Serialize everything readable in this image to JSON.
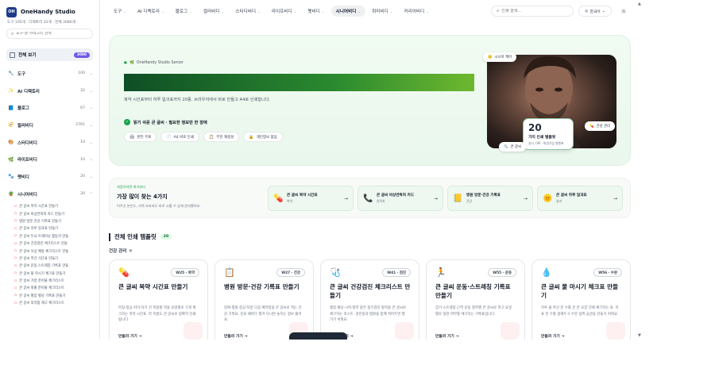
{
  "brand": {
    "name": "OneHandy Studio",
    "logo_text": "OH"
  },
  "sidebar": {
    "stats": "도구 105개 · 디렉토리 32개 · 전체 3080개",
    "search_placeholder": "도구·글 카테고리 검색",
    "all_view": {
      "label": "전체 보기",
      "count": "3080"
    },
    "categories": [
      {
        "icon": "🔧",
        "label": "도구",
        "count": "100",
        "chev": "⌄"
      },
      {
        "icon": "✨",
        "label": "AI 디렉토리",
        "count": "32",
        "chev": "⌄"
      },
      {
        "icon": "📘",
        "label": "블로그",
        "count": "67",
        "chev": "⌄"
      },
      {
        "icon": "🧭",
        "label": "컬러비디",
        "count": "2761",
        "chev": "⌄"
      },
      {
        "icon": "🎨",
        "label": "스터디비디",
        "count": "10",
        "chev": "⌄"
      },
      {
        "icon": "🌿",
        "label": "라이프비디",
        "count": "10",
        "chev": "⌄"
      },
      {
        "icon": "🐾",
        "label": "펫비디",
        "count": "20",
        "chev": "⌄"
      },
      {
        "icon": "🪴",
        "label": "시니어비디",
        "count": "20",
        "chev": "⌃"
      }
    ],
    "sub_items": [
      "큰 글씨 복약 시간표 만들기",
      "큰 글씨 비상연락처 카드 만들기",
      "병원 방문·건강 기록표 만들기",
      "큰 글씨 하루 일과표 만들기",
      "큰 글씨 두뇌 트레이닝 활동지 만들",
      "큰 글씨 건강검진 체크리스트 만들",
      "큰 글씨 낙상 예방 체크리스트 만들",
      "큰 글씨 주간 식단표 만들기",
      "큰 글씨 운동·스트레칭 기록표 만들",
      "큰 글씨 물 마시기 체크표 만들기",
      "큰 글씨 가방 준비물 체크리스트",
      "큰 글씨 외출 준비물 체크리스트",
      "큰 글씨 혈압 혈당 기록표 만들기",
      "큰 글씨 의약품 재고 체크리스트"
    ]
  },
  "nav": {
    "items": [
      {
        "label": "도구",
        "active": false
      },
      {
        "label": "AI 디렉토리",
        "active": false
      },
      {
        "label": "블로그",
        "active": false
      },
      {
        "label": "컬러비디",
        "active": false
      },
      {
        "label": "스터디비디",
        "active": false
      },
      {
        "label": "라이프비디",
        "active": false
      },
      {
        "label": "펫비디",
        "active": false
      },
      {
        "label": "시니어비디",
        "active": true
      },
      {
        "label": "취미비디",
        "active": false
      },
      {
        "label": "커리어비디",
        "active": false
      }
    ],
    "search_placeholder": "인쇄 검색...",
    "lang": "한국어"
  },
  "hero": {
    "kicker": "OneHandy Studio Senior",
    "desc": "복약 시간표부터 하루 일과표까지 20종. 브라우저에서 바로 만들고 A4로 인쇄합니다.",
    "check": "읽기 쉬운 큰 글씨 · 필요한 정보만 한 장에",
    "chips": [
      {
        "icon": "🖨",
        "label": "완전 무료"
      },
      {
        "icon": "📄",
        "label": "A4 바로 인쇄"
      },
      {
        "icon": "📋",
        "label": "무한 재생성"
      },
      {
        "icon": "🔒",
        "label": "개인정보 없음"
      }
    ],
    "pill_senior": "시니어 케어",
    "pill_health": "건강 관리",
    "pill_big": "큰 글씨",
    "count_num": "20",
    "count_title": "가지 인쇄 템플릿",
    "count_sub": "실시 기록 · 위생기입 병행표"
  },
  "popular": {
    "kicker": "처음이라면 여기부터",
    "title": "가장 많이 찾는 4가지",
    "desc": "어르신 본인도, 가족 보호자도 바로 고를 수 있게 준비했어요.",
    "cards": [
      {
        "icon": "💊",
        "title": "큰 글씨 복약 시간표",
        "sub": "복약"
      },
      {
        "icon": "📞",
        "title": "큰 글씨 비상연락처 카드",
        "sub": "연락처"
      },
      {
        "icon": "📒",
        "title": "병원 방문·건강 기록표",
        "sub": "건강"
      },
      {
        "icon": "🌞",
        "title": "큰 글씨 하루 일과표",
        "sub": "일과"
      }
    ]
  },
  "templates": {
    "title": "전체 인쇄 템플릿",
    "count": "20",
    "group": "건강 관리",
    "cards": [
      {
        "icon": "💊",
        "tag": "W25 · 복약",
        "title": "큰 글씨 복약 시간표 만들기",
        "desc": "아침·점심·저녁·자기 전 복용할 약을 요일별로 크게 체크하는 복약 시간표. 약 이름도 큰 글씨로 정확히 인쇄됩니다.",
        "go": "만들러 가기 →"
      },
      {
        "icon": "📋",
        "tag": "W27 · 건강",
        "title": "병원 방문·건강 기록표 만들기",
        "desc": "날짜·병원·증상·처방 다음 예약일을 큰 글씨로 적는 건강 기록표. 진료 때마다 챙겨 다니면 놓치는 정보 줄어요.",
        "go": "만들러 가기 →"
      },
      {
        "icon": "🩺",
        "tag": "W41 · 검진",
        "title": "큰 글씨 건강검진 체크리스트 만들기",
        "desc": "혈압·혈당·시력·청력 같은 정기검진 항목을 큰 글씨로 체크하는 리스트. 검진일과 병원을 함께 적어두면 챙기기 쉬워요.",
        "go": "만들러 가기 →"
      },
      {
        "icon": "🏃",
        "tag": "W55 · 운동",
        "title": "큰 글씨 운동·스트레칭 기록표 만들기",
        "desc": "걷기·스트레칭·근력 운동 항목별 큰 글씨로 적고 요일별로 실천 여부를 체크하는 기록표입니다.",
        "go": "만들러 가기 →"
      },
      {
        "icon": "💧",
        "tag": "W56 · 수분",
        "title": "큰 글씨 물 마시기 체크표 만들기",
        "desc": "하루 물 마신 잔 수를 큰 칸 모양 건에 체크하는 표. 목표 잔 수를 정해두고 수분 섭취 습관을 만들기 쉬워요.",
        "go": "만들러 가기 →"
      }
    ]
  },
  "colors": {
    "accent": "#16a34a",
    "brand": "#1e3a8a",
    "badge": "#6d5ae6"
  }
}
